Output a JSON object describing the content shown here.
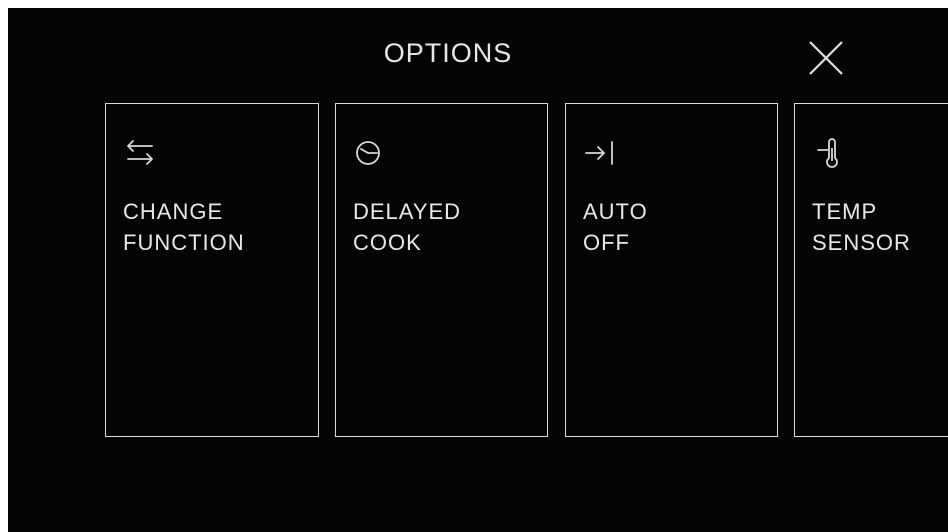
{
  "header": {
    "title": "OPTIONS"
  },
  "options": [
    {
      "line1": "CHANGE",
      "line2": "FUNCTION",
      "icon": "swap-arrows-icon"
    },
    {
      "line1": "DELAYED",
      "line2": "COOK",
      "icon": "clock-icon"
    },
    {
      "line1": "AUTO",
      "line2": "OFF",
      "icon": "arrow-to-end-icon"
    },
    {
      "line1": "TEMP",
      "line2": "SENSOR",
      "icon": "thermometer-icon"
    }
  ],
  "colors": {
    "background": "#050505",
    "foreground": "#e8e8e8",
    "card_border": "#d8d8d8"
  }
}
